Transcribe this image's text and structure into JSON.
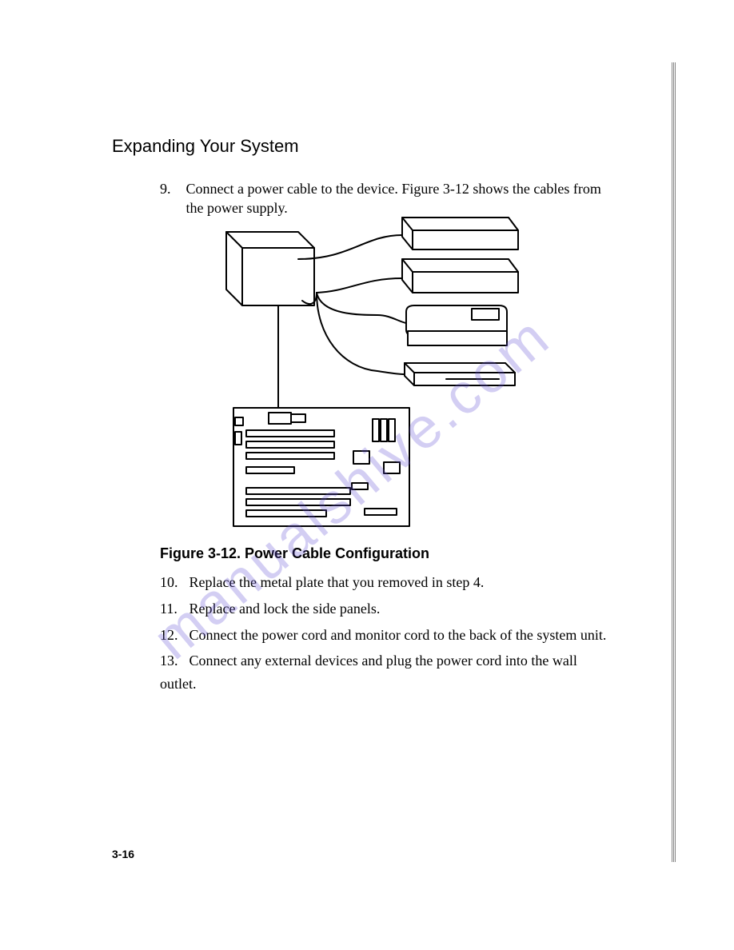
{
  "heading": "Expanding Your System",
  "step9": {
    "number": "9.",
    "text": "Connect a power cable to the device.  Figure 3-12 shows the cables from the power supply."
  },
  "figure_caption": "Figure 3-12.  Power Cable Configuration",
  "steps": [
    {
      "number": "10.",
      "text": "Replace the metal plate that you removed in step 4."
    },
    {
      "number": "11.",
      "text": "Replace and lock the side panels."
    },
    {
      "number": "12.",
      "text": "Connect the power cord and monitor cord to the back of the system unit."
    },
    {
      "number": "13.",
      "text": "Connect any external devices and plug the power cord into the wall outlet."
    }
  ],
  "page_number": "3-16",
  "watermark": "manualshive.com"
}
